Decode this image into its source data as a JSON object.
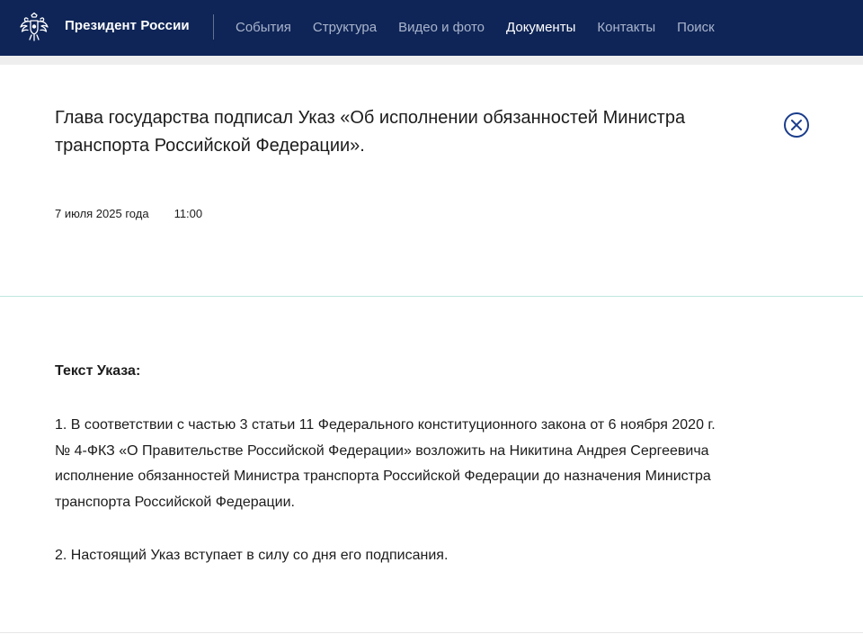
{
  "header": {
    "brand": "Президент России",
    "nav": [
      {
        "label": "События",
        "active": false
      },
      {
        "label": "Структура",
        "active": false
      },
      {
        "label": "Видео и фото",
        "active": false
      },
      {
        "label": "Документы",
        "active": true
      },
      {
        "label": "Контакты",
        "active": false
      },
      {
        "label": "Поиск",
        "active": false
      }
    ],
    "colors": {
      "background": "#0f2557",
      "nav_inactive": "#a9b4cc",
      "nav_active": "#ffffff"
    }
  },
  "document": {
    "title": "Глава государства подписал Указ «Об исполнении обязанностей Министра транспорта Российской Федерации».",
    "date": "7 июля 2025 года",
    "time": "11:00",
    "close_icon": "close-circle-icon",
    "accent_color": "#1a3c8c"
  },
  "body": {
    "heading": "Текст Указа:",
    "paragraphs": [
      "1. В соответствии с частью 3 статьи 11 Федерального конституционного закона от 6 ноября 2020 г. № 4-ФКЗ «О Правительстве Российской Федерации» возложить на Никитина Андрея Сергеевича исполнение обязанностей Министра транспорта Российской Федерации до назначения Министра транспорта Российской Федерации.",
      "2. Настоящий Указ вступает в силу со дня его подписания."
    ]
  }
}
